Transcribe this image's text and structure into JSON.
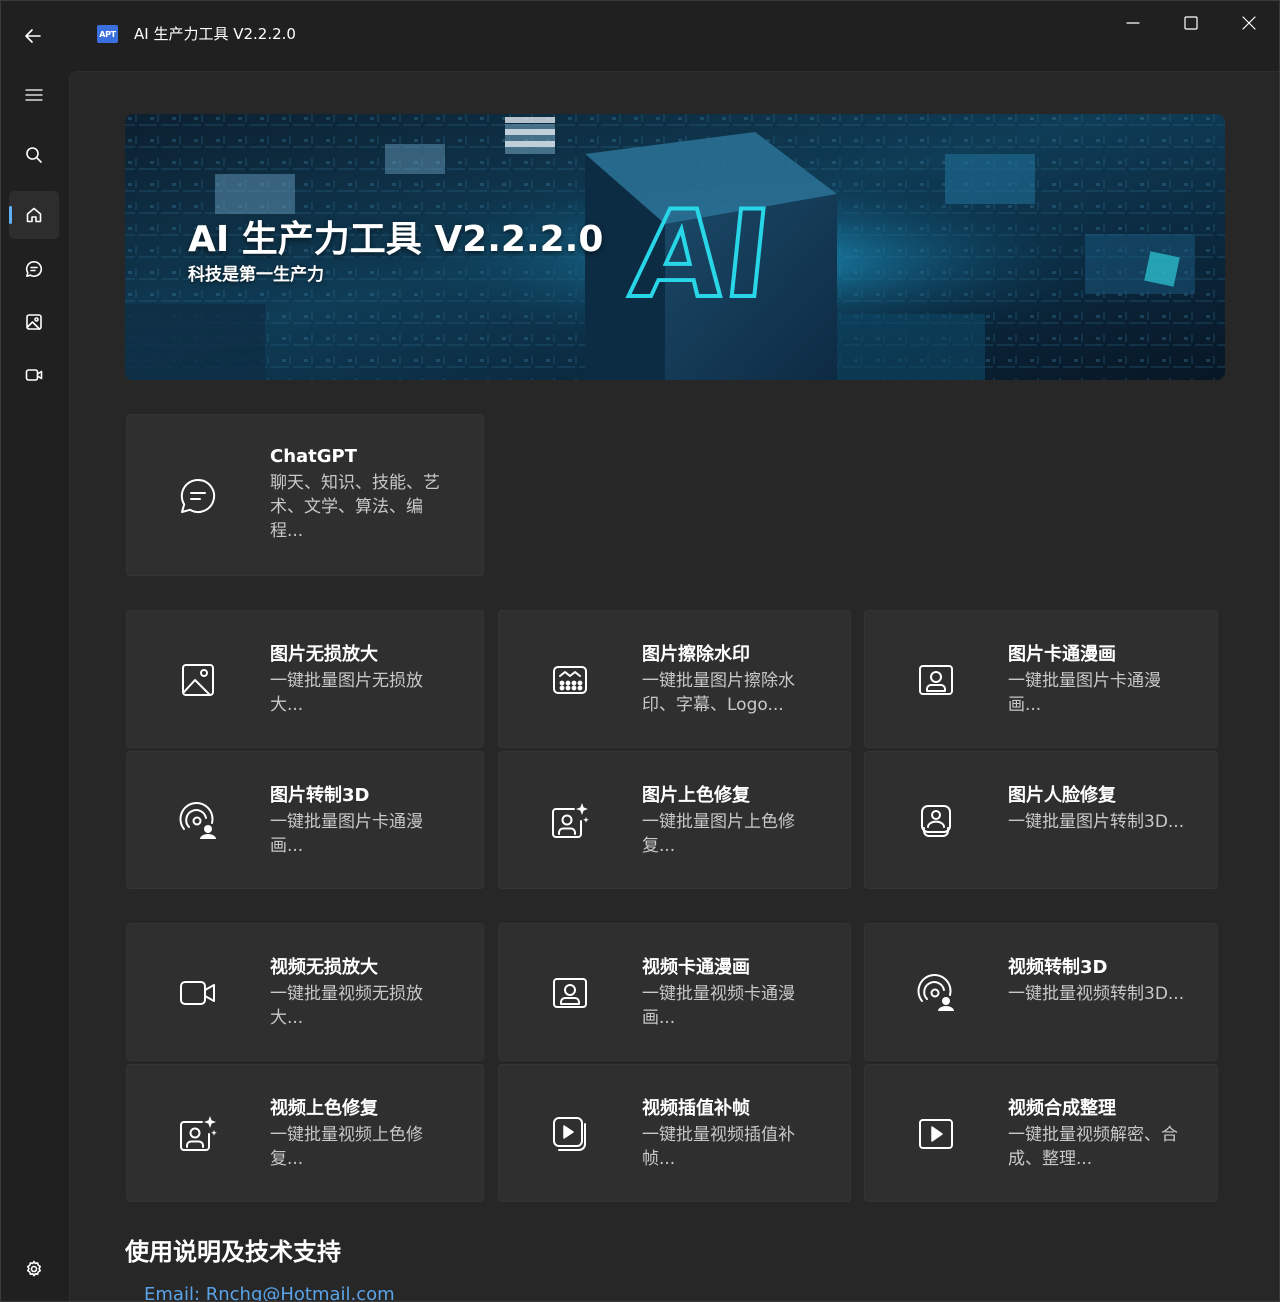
{
  "app": {
    "logo_text": "APT",
    "title": "AI 生产力工具 V2.2.2.0"
  },
  "banner": {
    "title": "AI 生产力工具 V2.2.2.0",
    "subtitle": "科技是第一生产力",
    "chip_text": "AI",
    "accent_color": "#29d6e8"
  },
  "cards": {
    "chatgpt": {
      "title": "ChatGPT",
      "desc": "聊天、知识、技能、艺术、文学、算法、编程..."
    },
    "img_upscale": {
      "title": "图片无损放大",
      "desc": "一键批量图片无损放大..."
    },
    "img_watermark": {
      "title": "图片擦除水印",
      "desc": "一键批量图片擦除水印、字幕、Logo..."
    },
    "img_cartoon": {
      "title": "图片卡通漫画",
      "desc": "一键批量图片卡通漫画..."
    },
    "img_3d": {
      "title": "图片转制3D",
      "desc": "一键批量图片卡通漫画..."
    },
    "img_colorize": {
      "title": "图片上色修复",
      "desc": "一键批量图片上色修复..."
    },
    "img_face": {
      "title": "图片人脸修复",
      "desc": "一键批量图片转制3D..."
    },
    "vid_upscale": {
      "title": "视频无损放大",
      "desc": "一键批量视频无损放大..."
    },
    "vid_cartoon": {
      "title": "视频卡通漫画",
      "desc": "一键批量视频卡通漫画..."
    },
    "vid_3d": {
      "title": "视频转制3D",
      "desc": "一键批量视频转制3D..."
    },
    "vid_colorize": {
      "title": "视频上色修复",
      "desc": "一键批量视频上色修复..."
    },
    "vid_interp": {
      "title": "视频插值补帧",
      "desc": "一键批量视频插值补帧..."
    },
    "vid_compose": {
      "title": "视频合成整理",
      "desc": "一键批量视频解密、合成、整理..."
    }
  },
  "support": {
    "title": "使用说明及技术支持",
    "email": "Email: Rnchg@Hotmail.com"
  },
  "colors": {
    "accent": "#60b0f4",
    "link": "#5aa3e8",
    "card_bg": "#2f2f2f"
  }
}
